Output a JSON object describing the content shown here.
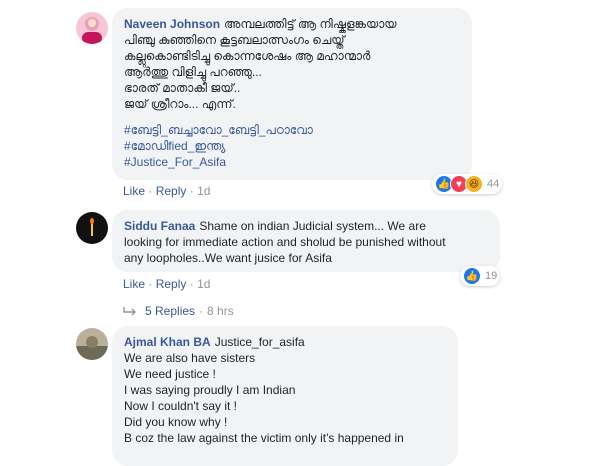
{
  "comments": [
    {
      "author": "Naveen Johnson",
      "lines": [
        "അമ്പലത്തിട്ട് ആ നിഷ്കളങ്കയായ",
        "പിഞ്ചു കുഞ്ഞിനെ കൂട്ടബലാത്സംഗം ചെയ്ത്",
        "കല്ലുകൊണ്ടിടിച്ചു കൊന്നശേഷം ആ മഹാന്മാർ",
        "ആർത്തു വിളിച്ചു പറഞ്ഞു...",
        "ഭാരത് മാതാകീ ജയ്..",
        "ജയ് ശ്രീറാം... എന്ന്."
      ],
      "tags": [
        "#ബേട്ടി_ബച്ചാവോ_ബേട്ടി_പഠാവോ",
        "#മോഡിfied_ഇന്ത്യ",
        "#Justice_For_Asifa"
      ],
      "like_label": "Like",
      "reply_label": "Reply",
      "time": "1d",
      "reaction_count": "44",
      "reactions": [
        "like-icon",
        "love-icon",
        "haha-icon"
      ]
    },
    {
      "author": "Siddu Fanaa",
      "lines": [
        "Shame on indian Judicial system... We are",
        "looking for immediate action and sholud be punished without",
        "any loopholes..We want jusice for Asifa"
      ],
      "like_label": "Like",
      "reply_label": "Reply",
      "time": "1d",
      "reaction_count": "19",
      "reactions": [
        "like-icon"
      ],
      "replies_label": "5 Replies",
      "replies_time": "8 hrs"
    },
    {
      "author": "Ajmal Khan BA",
      "lines": [
        "Justice_for_asifa",
        "We are also have sisters",
        "We need justice !",
        "I was saying proudly I am Indian",
        "Now I couldn't say it !",
        "Did you know why !",
        "B coz the law against the victim only it's happened in"
      ]
    }
  ],
  "colors": {
    "link": "#385898",
    "bubble": "#f2f3f5",
    "muted": "#90949c",
    "like": "#1877f2",
    "love": "#f33e58",
    "haha": "#f7b125"
  }
}
